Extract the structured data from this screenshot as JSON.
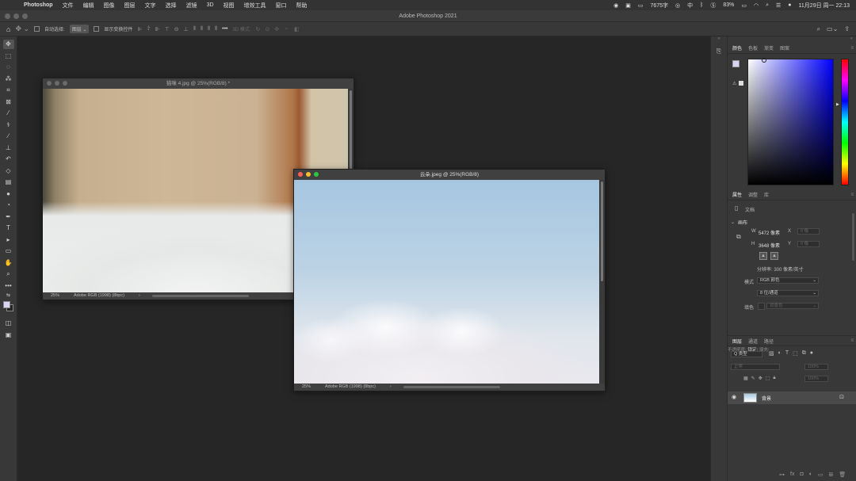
{
  "menubar": {
    "app": "Photoshop",
    "items": [
      "文件",
      "编辑",
      "图像",
      "图层",
      "文字",
      "选择",
      "滤镜",
      "3D",
      "视图",
      "增效工具",
      "窗口",
      "帮助"
    ],
    "status": {
      "word_count": "7675字",
      "input_method": "中",
      "battery": "83%",
      "datetime": "11月29日 周一 22:13"
    }
  },
  "window": {
    "title": "Adobe Photoshop 2021"
  },
  "options": {
    "auto_select_label": "自动选择:",
    "auto_select_value": "图层",
    "show_transform_label": "显示变换控件",
    "mode_3d_label": "3D 模式:"
  },
  "toolbar": {
    "tools": [
      "move-tool",
      "marquee-tool",
      "lasso-tool",
      "magic-wand-tool",
      "crop-tool",
      "frame-tool",
      "eyedropper-tool",
      "healing-brush-tool",
      "brush-tool",
      "clone-stamp-tool",
      "history-brush-tool",
      "eraser-tool",
      "gradient-tool",
      "blur-tool",
      "dodge-tool",
      "pen-tool",
      "type-tool",
      "path-selection-tool",
      "rectangle-tool",
      "hand-tool",
      "zoom-tool",
      "more-tools"
    ],
    "foreground_color": "#d7d5f2",
    "background_color": "#222222"
  },
  "docs": [
    {
      "title": "猫咪 4.jpg @ 25%(RGB/8) *",
      "zoom": "25%",
      "profile": "Adobe RGB (1998) (8bpc)"
    },
    {
      "title": "云朵.jpeg @ 25%(RGB/8)",
      "zoom": "25%",
      "profile": "Adobe RGB (1998) (8bpc)"
    }
  ],
  "color_panel": {
    "tabs": [
      "颜色",
      "色板",
      "渐变",
      "图案"
    ]
  },
  "properties_panel": {
    "tabs": [
      "属性",
      "调整",
      "库"
    ],
    "doc_label": "文档",
    "canvas_label": "画布",
    "w_label": "W",
    "w_value": "5472 像素",
    "x_label": "X",
    "x_value": "0 像",
    "h_label": "H",
    "h_value": "3648 像素",
    "y_label": "Y",
    "y_value": "0 像",
    "resolution": "分辨率: 300 像素/英寸",
    "mode_label": "模式",
    "mode_value": "RGB 颜色",
    "depth_value": "8 位/通道",
    "fill_label": "填色",
    "fill_value": "背景色"
  },
  "layers_panel": {
    "tabs": [
      "图层",
      "通道",
      "路径"
    ],
    "filter_label": "Q 类型",
    "blend_mode": "正常",
    "opacity_label": "不透明度:",
    "opacity_value": "100%",
    "lock_label": "锁定:",
    "fill_label": "填充:",
    "fill_value": "100%",
    "layer_name": "背景"
  }
}
